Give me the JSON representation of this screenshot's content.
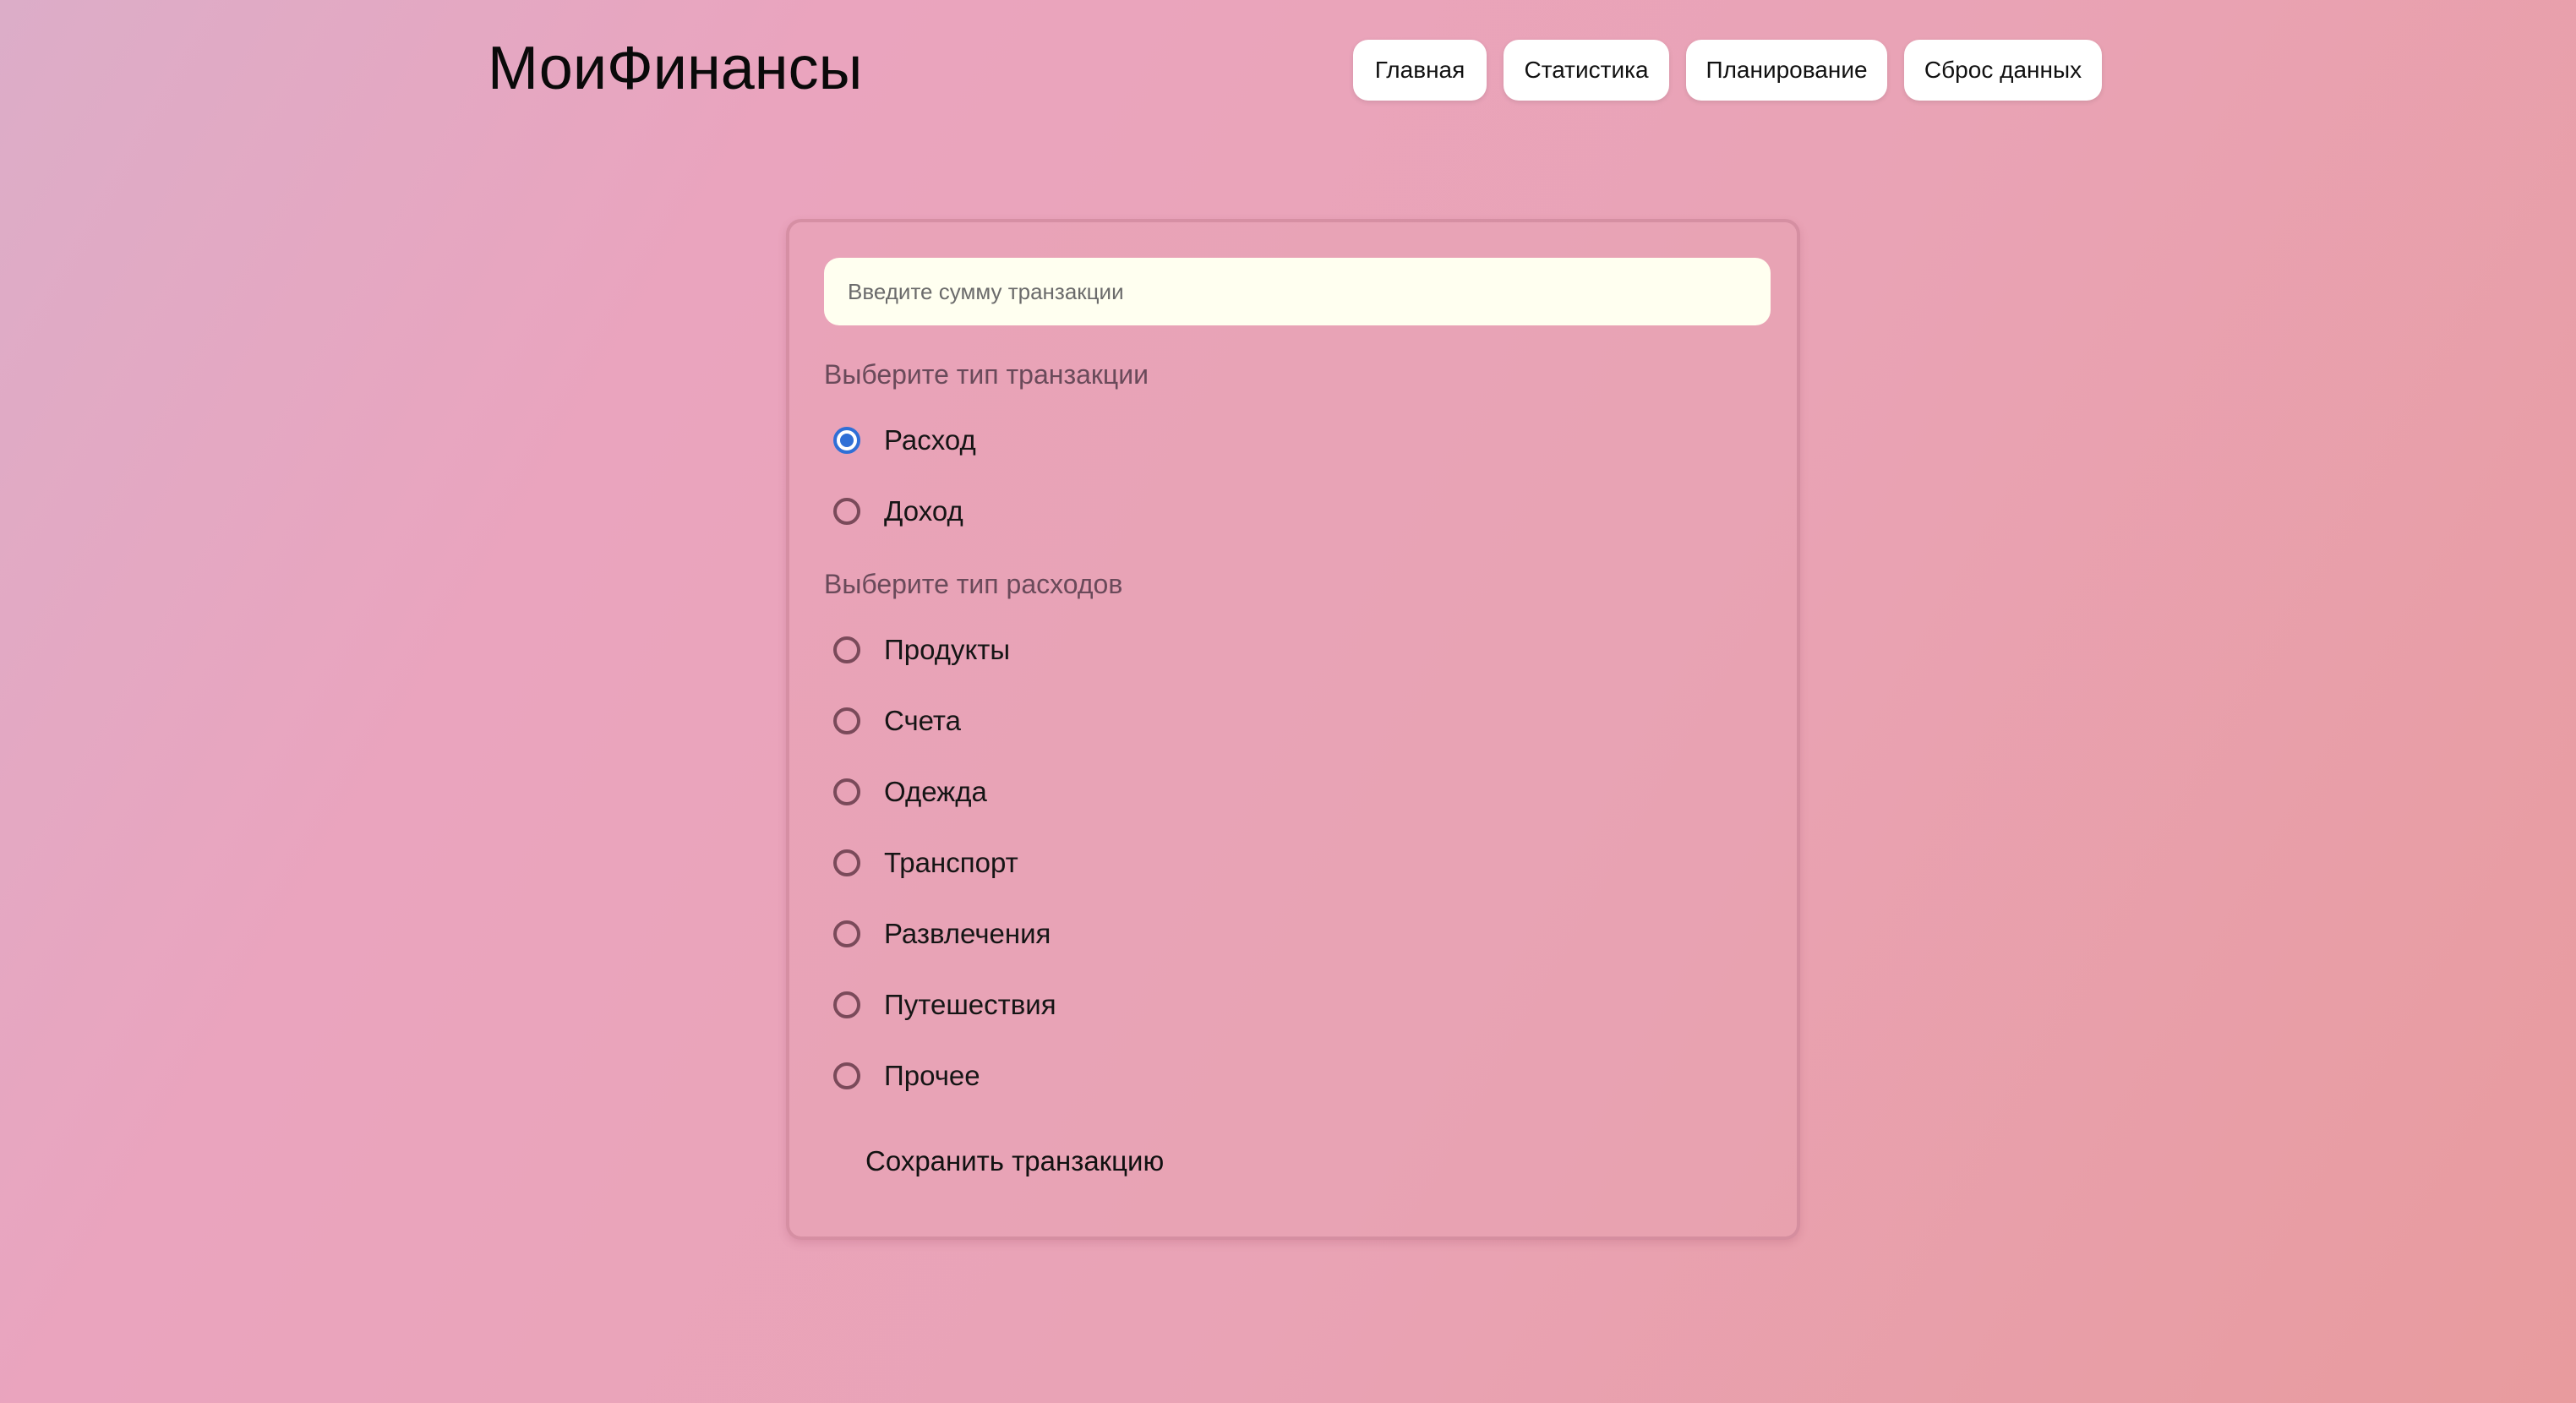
{
  "header": {
    "logo": "МоиФинансы",
    "nav": [
      {
        "label": "Главная"
      },
      {
        "label": "Статистика"
      },
      {
        "label": "Планирование"
      },
      {
        "label": "Сброс данных"
      }
    ]
  },
  "form": {
    "amount": {
      "placeholder": "Введите сумму транзакции",
      "value": ""
    },
    "transaction_type": {
      "label": "Выберите тип транзакции",
      "selected": "Расход",
      "options": [
        {
          "label": "Расход",
          "checked": true
        },
        {
          "label": "Доход",
          "checked": false
        }
      ]
    },
    "expense_type": {
      "label": "Выберите тип расходов",
      "selected": "",
      "options": [
        {
          "label": "Продукты",
          "checked": false
        },
        {
          "label": "Счета",
          "checked": false
        },
        {
          "label": "Одежда",
          "checked": false
        },
        {
          "label": "Транспорт",
          "checked": false
        },
        {
          "label": "Развлечения",
          "checked": false
        },
        {
          "label": "Путешествия",
          "checked": false
        },
        {
          "label": "Прочее",
          "checked": false
        }
      ]
    },
    "save_label": "Сохранить транзакцию"
  },
  "colors": {
    "accent": "#2f6fd6",
    "input_background": "#fffff0",
    "section_label": "#6a4a5a"
  }
}
